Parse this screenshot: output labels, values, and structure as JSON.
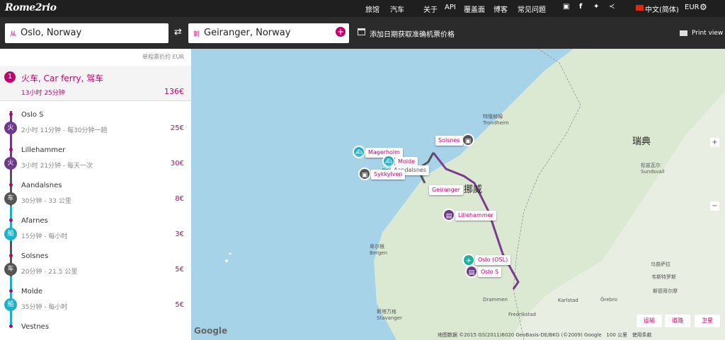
{
  "brand": "Rome2rio",
  "nav": [
    "旅馆",
    "汽车",
    "关于",
    "API",
    "覆盖面",
    "博客",
    "常见问题"
  ],
  "lang": "中文(简体)",
  "currency": "EUR",
  "search": {
    "from_prefix": "从",
    "from": "Oslo, Norway",
    "to_prefix": "到",
    "to": "Geiranger, Norway",
    "date_text": "添加日期获取准确机票价格",
    "print": "Print view"
  },
  "sidebar": {
    "price_header": "单程票价约 EUR",
    "route": {
      "num": "1",
      "title": "火车, Car ferry, 驾车",
      "duration": "13小时 25分钟",
      "price": "136€"
    },
    "stops": [
      {
        "name": "Oslo S",
        "detail": "2小时 11分钟 - 每30分钟一趟",
        "price": "25€",
        "mode": "火",
        "color": "#6c3a88"
      },
      {
        "name": "Lillehammer",
        "detail": "3小时 21分钟 - 每天一次",
        "price": "30€",
        "mode": "火",
        "color": "#6c3a88"
      },
      {
        "name": "Aandalsnes",
        "detail": "30分钟 - 33 公里",
        "price": "8€",
        "mode": "车",
        "color": "#555555"
      },
      {
        "name": "Afarnes",
        "detail": "15分钟 - 每小时",
        "price": "3€",
        "mode": "船",
        "color": "#1fb0c8"
      },
      {
        "name": "Solsnes",
        "detail": "20分钟 - 21.5 公里",
        "price": "5€",
        "mode": "车",
        "color": "#555555"
      },
      {
        "name": "Molde",
        "detail": "35分钟 - 每小时",
        "price": "5€",
        "mode": "船",
        "color": "#1fb0c8"
      },
      {
        "name": "Vestnes",
        "detail": "",
        "price": "",
        "mode": "",
        "color": ""
      }
    ]
  },
  "map": {
    "country_no": "挪威",
    "country_se": "瑞典",
    "cities": [
      {
        "t": "特隆赫姆",
        "t2": "Trondheim"
      },
      {
        "t": "卑尔根",
        "t2": "Bergen"
      },
      {
        "t": "斯塔万格",
        "t2": "Stavanger"
      },
      {
        "t": "Drammen"
      },
      {
        "t": "松兹瓦尔",
        "t2": "Sundsvall"
      },
      {
        "t": "Karlstad"
      },
      {
        "t": "Fredrikstad"
      },
      {
        "t": "斯德哥尔摩"
      },
      {
        "t": "Örebro"
      },
      {
        "t": "乌普萨拉"
      },
      {
        "t": "韦斯特罗斯"
      }
    ],
    "markers": [
      "Solsnes",
      "Magerholm",
      "Molde",
      "Aandalsnes",
      "Sykkylven",
      "Geiranger",
      "Lillehammer",
      "Oslo (OSL)",
      "Oslo S"
    ],
    "types": [
      "运输",
      "道路",
      "卫星"
    ],
    "copyright": "地图数据 ©2015 GS(2011)6020 GeoBasis-DE/BKG (©2009) Google",
    "scale": "100 公里",
    "terms": "使用条款",
    "google": "Google"
  }
}
